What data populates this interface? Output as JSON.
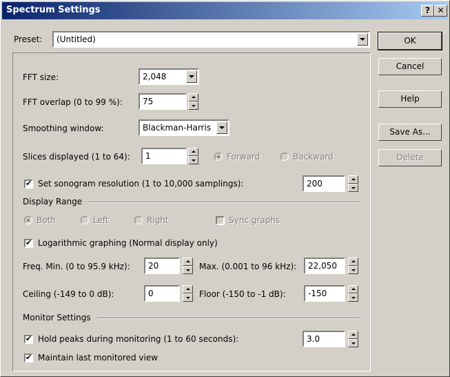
{
  "window": {
    "title": "Spectrum Settings",
    "help_glyph": "?",
    "close_glyph": "✕"
  },
  "preset": {
    "label": "Preset:",
    "value": "(Untitled)"
  },
  "buttons": {
    "ok": "OK",
    "cancel": "Cancel",
    "help": "Help",
    "save_as": "Save As...",
    "delete": "Delete"
  },
  "fft": {
    "size_label": "FFT size:",
    "size_value": "2,048",
    "overlap_label": "FFT overlap (0 to 99 %):",
    "overlap_value": "75",
    "smoothing_label": "Smoothing window:",
    "smoothing_value": "Blackman-Harris",
    "slices_label": "Slices displayed (1 to 64):",
    "slices_value": "1",
    "forward_label": "Forward",
    "backward_label": "Backward"
  },
  "sonogram": {
    "label": "Set sonogram resolution (1 to 10,000 samplings):",
    "value": "200",
    "checked": true
  },
  "display_range": {
    "heading": "Display Range",
    "both_label": "Both",
    "left_label": "Left",
    "right_label": "Right",
    "sync_label": "Sync graphs",
    "log_label": "Logarithmic graphing (Normal display only)",
    "log_checked": true,
    "freq_min_label": "Freq. Min. (0 to 95.9 kHz):",
    "freq_min_value": "20",
    "freq_max_label": "Max. (0.001 to 96 kHz):",
    "freq_max_value": "22,050",
    "ceiling_label": "Ceiling (-149 to 0 dB):",
    "ceiling_value": "0",
    "floor_label": "Floor (-150 to -1 dB):",
    "floor_value": "-150"
  },
  "monitor": {
    "heading": "Monitor Settings",
    "hold_label": "Hold peaks during monitoring (1 to 60 seconds):",
    "hold_value": "3.0",
    "hold_checked": true,
    "maintain_label": "Maintain last monitored view",
    "maintain_checked": true
  },
  "colors": {
    "face": "#d4d0c8",
    "title_start": "#0a246a",
    "title_end": "#a6caf0",
    "disabled_text": "#808080"
  }
}
